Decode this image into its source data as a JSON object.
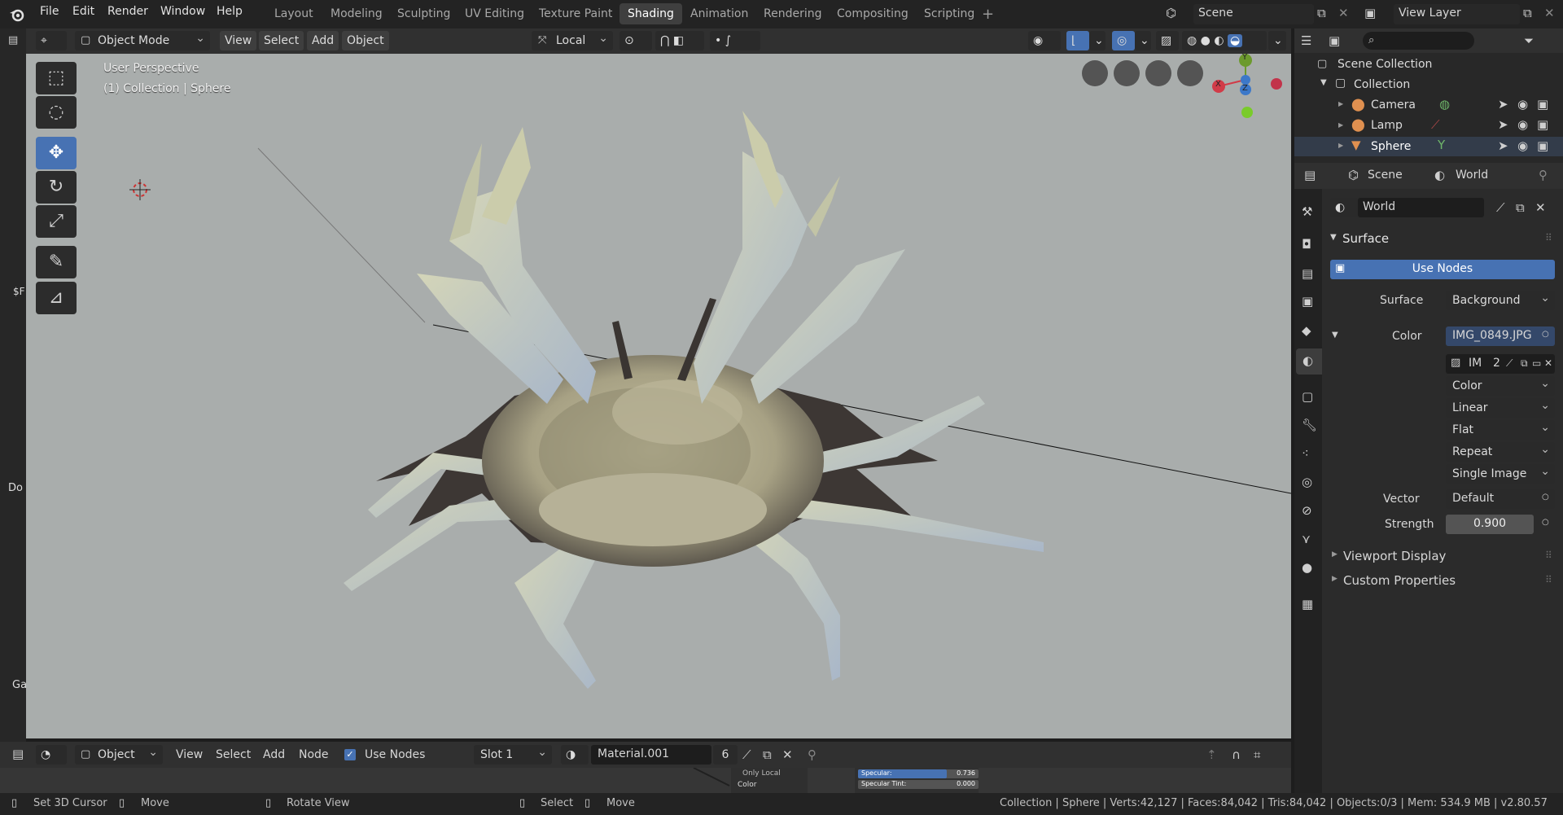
{
  "menus": [
    "File",
    "Edit",
    "Render",
    "Window",
    "Help"
  ],
  "workspaces": [
    "Layout",
    "Modeling",
    "Sculpting",
    "UV Editing",
    "Texture Paint",
    "Shading",
    "Animation",
    "Rendering",
    "Compositing",
    "Scripting"
  ],
  "active_workspace": "Shading",
  "scene_field": "Scene",
  "view_layer_field": "View Layer",
  "viewport": {
    "mode": "Object Mode",
    "menus": [
      "View",
      "Select",
      "Add",
      "Object"
    ],
    "transform_orientation": "Local",
    "overlay_line1": "User Perspective",
    "overlay_line2": "(1) Collection | Sphere",
    "gizmo_x": "X",
    "gizmo_y": "Y",
    "gizmo_z": "Z",
    "left_edge_text": [
      "$F",
      "Do",
      "Ga"
    ]
  },
  "outliner": {
    "root": "Scene Collection",
    "collection": "Collection",
    "items": [
      "Camera",
      "Lamp",
      "Sphere"
    ]
  },
  "properties": {
    "tabs": [
      "Scene",
      "World"
    ],
    "world_name": "World",
    "surface_panel": "Surface",
    "use_nodes_button": "Use Nodes",
    "surface_label": "Surface",
    "surface_value": "Background",
    "color_label": "Color",
    "color_value": "IMG_0849.JPG",
    "image_short": "IM",
    "image_users": "2",
    "dropdowns": [
      "Color",
      "Linear",
      "Flat",
      "Repeat",
      "Single Image"
    ],
    "vector_label": "Vector",
    "vector_value": "Default",
    "strength_label": "Strength",
    "strength_value": "0.900",
    "strength_fraction": 0.9,
    "viewport_display": "Viewport Display",
    "custom_properties": "Custom Properties"
  },
  "node_editor": {
    "type": "Object",
    "menus": [
      "View",
      "Select",
      "Add",
      "Node"
    ],
    "use_nodes_label": "Use Nodes",
    "slot": "Slot 1",
    "material": "Material.001",
    "users": "6",
    "node_only_local": "Only Local",
    "node_color": "Color",
    "specular_label": "Specular:",
    "specular_value": "0.736",
    "specular_fraction": 0.736,
    "specular_tint_label": "Specular Tint:",
    "specular_tint_value": "0.000"
  },
  "statusbar": {
    "set_cursor": "Set 3D Cursor",
    "move1": "Move",
    "rotate": "Rotate View",
    "select": "Select",
    "move2": "Move",
    "stats": "Collection | Sphere | Verts:42,127 | Faces:84,042 | Tris:84,042 | Objects:0/3 | Mem: 534.9 MB | v2.80.57"
  },
  "colors": {
    "accent": "#4772b3",
    "viewport_bg": "#a9adac",
    "header": "#303030",
    "panel": "#2b2b2b"
  }
}
